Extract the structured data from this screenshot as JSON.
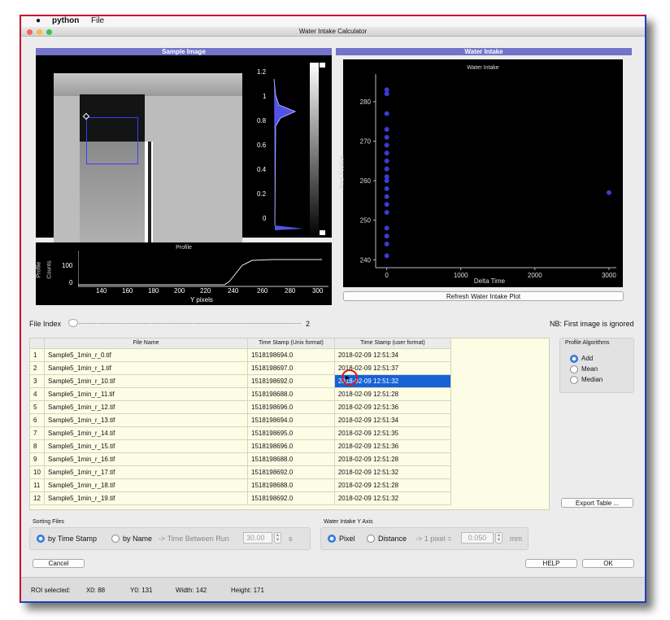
{
  "menubar": {
    "apple": "",
    "app": "python",
    "file": "File"
  },
  "window": {
    "title": "Water Intake Calculator"
  },
  "sample_panel": {
    "header": "Sample Image",
    "hist_ticks": [
      "1.2",
      "1",
      "0.8",
      "0.6",
      "0.4",
      "0.2",
      "0"
    ]
  },
  "profile_panel": {
    "title": "Profile",
    "ylabel_a": "Profile",
    "ylabel_b": "Counts",
    "yticks": [
      "100",
      "0"
    ],
    "xticks": [
      "140",
      "160",
      "180",
      "200",
      "220",
      "240",
      "260",
      "280",
      "300"
    ],
    "xlabel": "Y pixels"
  },
  "water_panel": {
    "header": "Water Intake",
    "refresh_label": "Refresh Water Intake Plot"
  },
  "chart_data": {
    "type": "scatter",
    "title": "Water Intake",
    "xlabel": "Delta Time",
    "ylabel": "Pixel Position",
    "xlim": [
      -150,
      3100
    ],
    "ylim": [
      238,
      287
    ],
    "xticks": [
      "0",
      "1000",
      "2000",
      "3000"
    ],
    "yticks": [
      "240",
      "250",
      "260",
      "270",
      "280"
    ],
    "marker_color": "#3a3bd4",
    "points": [
      {
        "x": 0,
        "y": 283
      },
      {
        "x": 0,
        "y": 282
      },
      {
        "x": 0,
        "y": 277
      },
      {
        "x": 0,
        "y": 273
      },
      {
        "x": 0,
        "y": 271
      },
      {
        "x": 0,
        "y": 269
      },
      {
        "x": 0,
        "y": 267
      },
      {
        "x": 0,
        "y": 265
      },
      {
        "x": 0,
        "y": 263
      },
      {
        "x": 0,
        "y": 261
      },
      {
        "x": 0,
        "y": 260
      },
      {
        "x": 0,
        "y": 258
      },
      {
        "x": 0,
        "y": 256
      },
      {
        "x": 0,
        "y": 254
      },
      {
        "x": 0,
        "y": 252
      },
      {
        "x": 0,
        "y": 248
      },
      {
        "x": 0,
        "y": 246
      },
      {
        "x": 0,
        "y": 244
      },
      {
        "x": 0,
        "y": 241
      },
      {
        "x": 3000,
        "y": 257
      }
    ]
  },
  "file_index": {
    "label": "File Index",
    "value": "2",
    "note": "NB: First image is ignored"
  },
  "table": {
    "headers": [
      "",
      "File Name",
      "Time Stamp (Unix format)",
      "Time Stamp (user format)"
    ],
    "rows": [
      [
        "1",
        "Sample5_1min_r_0.tif",
        "1518198694.0",
        "2018-02-09 12:51:34"
      ],
      [
        "2",
        "Sample5_1min_r_1.tif",
        "1518198697.0",
        "2018-02-09 12:51:37"
      ],
      [
        "3",
        "Sample5_1min_r_10.tif",
        "1518198692.0",
        "2018-02-09 12:51:32"
      ],
      [
        "4",
        "Sample5_1min_r_11.tif",
        "1518198688.0",
        "2018-02-09 12:51:28"
      ],
      [
        "5",
        "Sample5_1min_r_12.tif",
        "1518198696.0",
        "2018-02-09 12:51:36"
      ],
      [
        "6",
        "Sample5_1min_r_13.tif",
        "1518198694.0",
        "2018-02-09 12:51:34"
      ],
      [
        "7",
        "Sample5_1min_r_14.tif",
        "1518198695.0",
        "2018-02-09 12:51:35"
      ],
      [
        "8",
        "Sample5_1min_r_15.tif",
        "1518198696.0",
        "2018-02-09 12:51:36"
      ],
      [
        "9",
        "Sample5_1min_r_16.tif",
        "1518198688.0",
        "2018-02-09 12:51:28"
      ],
      [
        "10",
        "Sample5_1min_r_17.tif",
        "1518198692.0",
        "2018-02-09 12:51:32"
      ],
      [
        "11",
        "Sample5_1min_r_18.tif",
        "1518198688.0",
        "2018-02-09 12:51:28"
      ],
      [
        "12",
        "Sample5_1min_r_19.tif",
        "1518198692.0",
        "2018-02-09 12:51:32"
      ]
    ]
  },
  "profile_algorithms": {
    "title": "Profile Algorithms",
    "options": [
      "Add",
      "Mean",
      "Median"
    ],
    "selected": "Add"
  },
  "export_label": "Export Table ...",
  "sorting": {
    "title": "Sorting Files",
    "by_time": "by Time Stamp",
    "by_name": "by Name",
    "between_label": "-> Time Between Run",
    "between_value": "30.00",
    "unit": "s"
  },
  "y_axis": {
    "title": "Water Intake Y Axis",
    "pixel": "Pixel",
    "distance": "Distance",
    "conv_label": "-> 1 pixel =",
    "conv_value": "0.050",
    "unit": "mm"
  },
  "buttons": {
    "cancel": "Cancel",
    "help": "HELP",
    "ok": "OK"
  },
  "status": {
    "roi_label": "ROI selected:",
    "x0": "X0:  88",
    "y0": "Y0:  131",
    "width": "Width:  142",
    "height": "Height:  171"
  }
}
